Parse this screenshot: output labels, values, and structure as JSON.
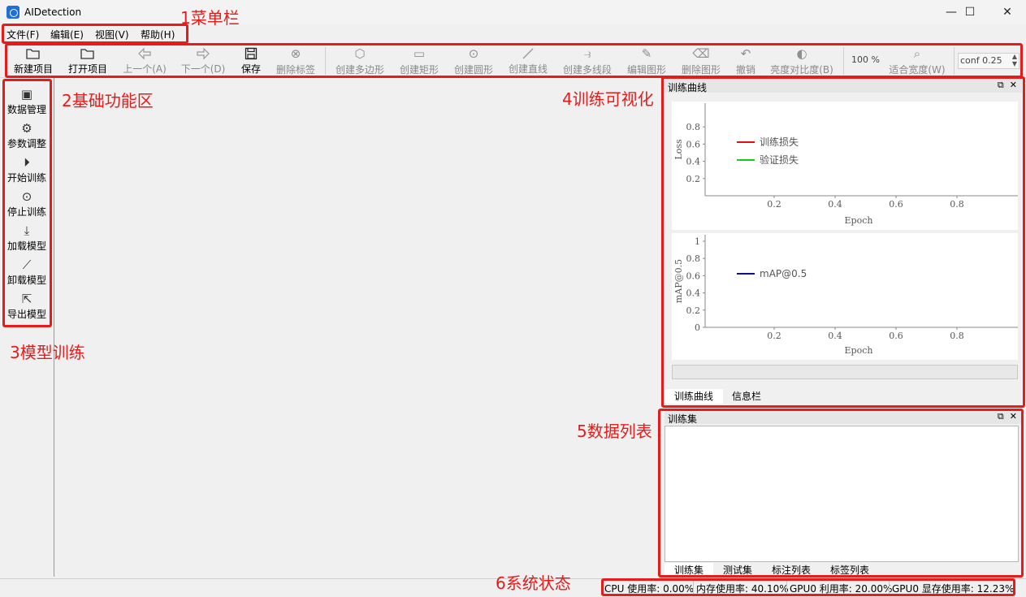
{
  "window": {
    "title": "AIDetection",
    "controls": [
      "—",
      "☐",
      "✕"
    ]
  },
  "menu": [
    "文件(F)",
    "编辑(E)",
    "视图(V)",
    "帮助(H)"
  ],
  "toolbar": {
    "tools": [
      {
        "label": "新建项目",
        "icon": "folder-open-icon",
        "enabled": true
      },
      {
        "label": "打开项目",
        "icon": "folder-open-icon",
        "enabled": true
      },
      {
        "label": "上一个(A)",
        "icon": "arrow-left-icon",
        "enabled": false
      },
      {
        "label": "下一个(D)",
        "icon": "arrow-right-icon",
        "enabled": false
      },
      {
        "label": "保存",
        "icon": "save-icon",
        "enabled": true
      },
      {
        "label": "删除标签",
        "icon": "delete-circle-icon",
        "enabled": false
      },
      {
        "label": "创建多边形",
        "icon": "polygon-icon",
        "enabled": false
      },
      {
        "label": "创建矩形",
        "icon": "rectangle-icon",
        "enabled": false
      },
      {
        "label": "创建圆形",
        "icon": "circle-icon",
        "enabled": false
      },
      {
        "label": "创建直线",
        "icon": "line-icon",
        "enabled": false
      },
      {
        "label": "创建多线段",
        "icon": "polyline-icon",
        "enabled": false
      },
      {
        "label": "编辑图形",
        "icon": "edit-shape-icon",
        "enabled": false
      },
      {
        "label": "删除图形",
        "icon": "delete-shape-icon",
        "enabled": false
      },
      {
        "label": "撤销",
        "icon": "undo-icon",
        "enabled": false
      },
      {
        "label": "亮度对比度(B)",
        "icon": "contrast-icon",
        "enabled": false
      },
      {
        "label": "适合宽度(W)",
        "icon": "zoom-fit-icon",
        "enabled": false
      }
    ],
    "zoom": "100 %",
    "conf": "conf 0.25"
  },
  "left_panel": [
    {
      "label": "数据管理",
      "icon": "data-manage-icon"
    },
    {
      "label": "参数调整",
      "icon": "settings-doc-icon"
    },
    {
      "label": "开始训练",
      "icon": "play-icon"
    },
    {
      "label": "停止训练",
      "icon": "stop-icon"
    },
    {
      "label": "加载模型",
      "icon": "download-icon"
    },
    {
      "label": "卸载模型",
      "icon": "unload-icon"
    },
    {
      "label": "导出模型",
      "icon": "export-icon"
    }
  ],
  "training_dock": {
    "title": "训练曲线",
    "tabs": [
      "训练曲线",
      "信息栏"
    ],
    "loss_chart": {
      "ylabel": "Loss",
      "xlabel": "Epoch",
      "yticks": [
        "0.8",
        "0.6",
        "0.4",
        "0.2"
      ],
      "xticks": [
        "0.2",
        "0.4",
        "0.6",
        "0.8"
      ],
      "legend": [
        "训练损失",
        "验证损失"
      ]
    },
    "map_chart": {
      "ylabel": "mAP@0.5",
      "xlabel": "Epoch",
      "yticks": [
        "1",
        "0.8",
        "0.6",
        "0.4",
        "0.2",
        "0"
      ],
      "xticks": [
        "0.2",
        "0.4",
        "0.6",
        "0.8"
      ],
      "legend": [
        "mAP@0.5"
      ]
    }
  },
  "chart_data": [
    {
      "type": "line",
      "xlabel": "Epoch",
      "ylabel": "Loss",
      "xlim": [
        0,
        1
      ],
      "ylim": [
        0,
        1
      ],
      "series": [
        {
          "name": "训练损失",
          "values": []
        },
        {
          "name": "验证损失",
          "values": []
        }
      ],
      "colors": [
        "#e01010",
        "#10d010"
      ],
      "legend_position": "top-left"
    },
    {
      "type": "line",
      "xlabel": "Epoch",
      "ylabel": "mAP@0.5",
      "xlim": [
        0,
        1
      ],
      "ylim": [
        0,
        1
      ],
      "series": [
        {
          "name": "mAP@0.5",
          "values": []
        }
      ],
      "colors": [
        "#10108a"
      ],
      "legend_position": "top-left"
    }
  ],
  "dataset_dock": {
    "title": "训练集",
    "tabs": [
      "训练集",
      "测试集",
      "标注列表",
      "标签列表"
    ]
  },
  "status": [
    "CPU 使用率: 0.00%",
    "内存使用率: 40.10%",
    "GPU0 利用率: 20.00%",
    "GPU0 显存使用率: 12.23%"
  ],
  "annotations": [
    "1菜单栏",
    "2基础功能区",
    "3模型训练",
    "4训练可视化",
    "5数据列表",
    "6系统状态"
  ],
  "accent_color": "#e81b1b"
}
